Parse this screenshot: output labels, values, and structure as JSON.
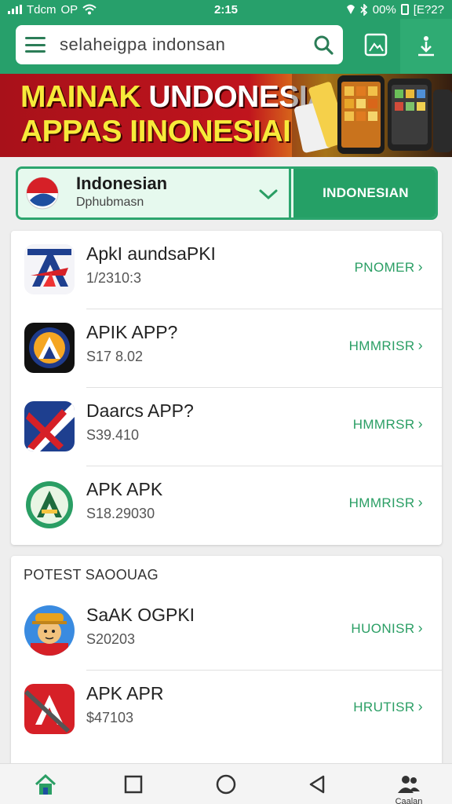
{
  "status": {
    "carrier": "Tdcm",
    "carrier_extra": "OP",
    "time": "2:15",
    "battery": "00%",
    "extra": "[E?2?"
  },
  "search": {
    "value": "selaheigpa indonsan",
    "placeholder": ""
  },
  "banner": {
    "line1_yellow": "MAINAK",
    "line1_white": " UNDONESIA",
    "line2": "APPAS IINONESIAI"
  },
  "selector": {
    "title": "Indonesian",
    "subtitle": "Dphubmasn",
    "button": "INDONESIAN"
  },
  "apps": [
    {
      "name": "ApkI aundsaPKI",
      "size": "1/2310:3",
      "action": "PNOMER"
    },
    {
      "name": "APIK APP?",
      "size": "S17 8.02",
      "action": "HMMRISR"
    },
    {
      "name": "Daarcs APP?",
      "size": "S39.410",
      "action": "HMMRSR"
    },
    {
      "name": "APK APK",
      "size": "S18.29030",
      "action": "HMMRISR"
    }
  ],
  "section2": {
    "heading": "POTEST SAOOUAG",
    "apps": [
      {
        "name": "SaAK OGPKI",
        "size": "S20203",
        "action": "HUONISR"
      },
      {
        "name": "APK APR",
        "size": "$47103",
        "action": "HRUTISR"
      }
    ]
  },
  "navbar": {
    "last_label": "Caalan"
  },
  "colors": {
    "brand_green": "#27a06b",
    "action_green": "#2a9e64",
    "banner_red": "#b8121b",
    "banner_yellow": "#f7ea3a"
  },
  "icons": [
    "menu-icon",
    "search-icon",
    "image-icon",
    "download-icon",
    "check-icon",
    "home-icon",
    "square-icon",
    "circle-icon",
    "back-icon",
    "people-icon"
  ]
}
